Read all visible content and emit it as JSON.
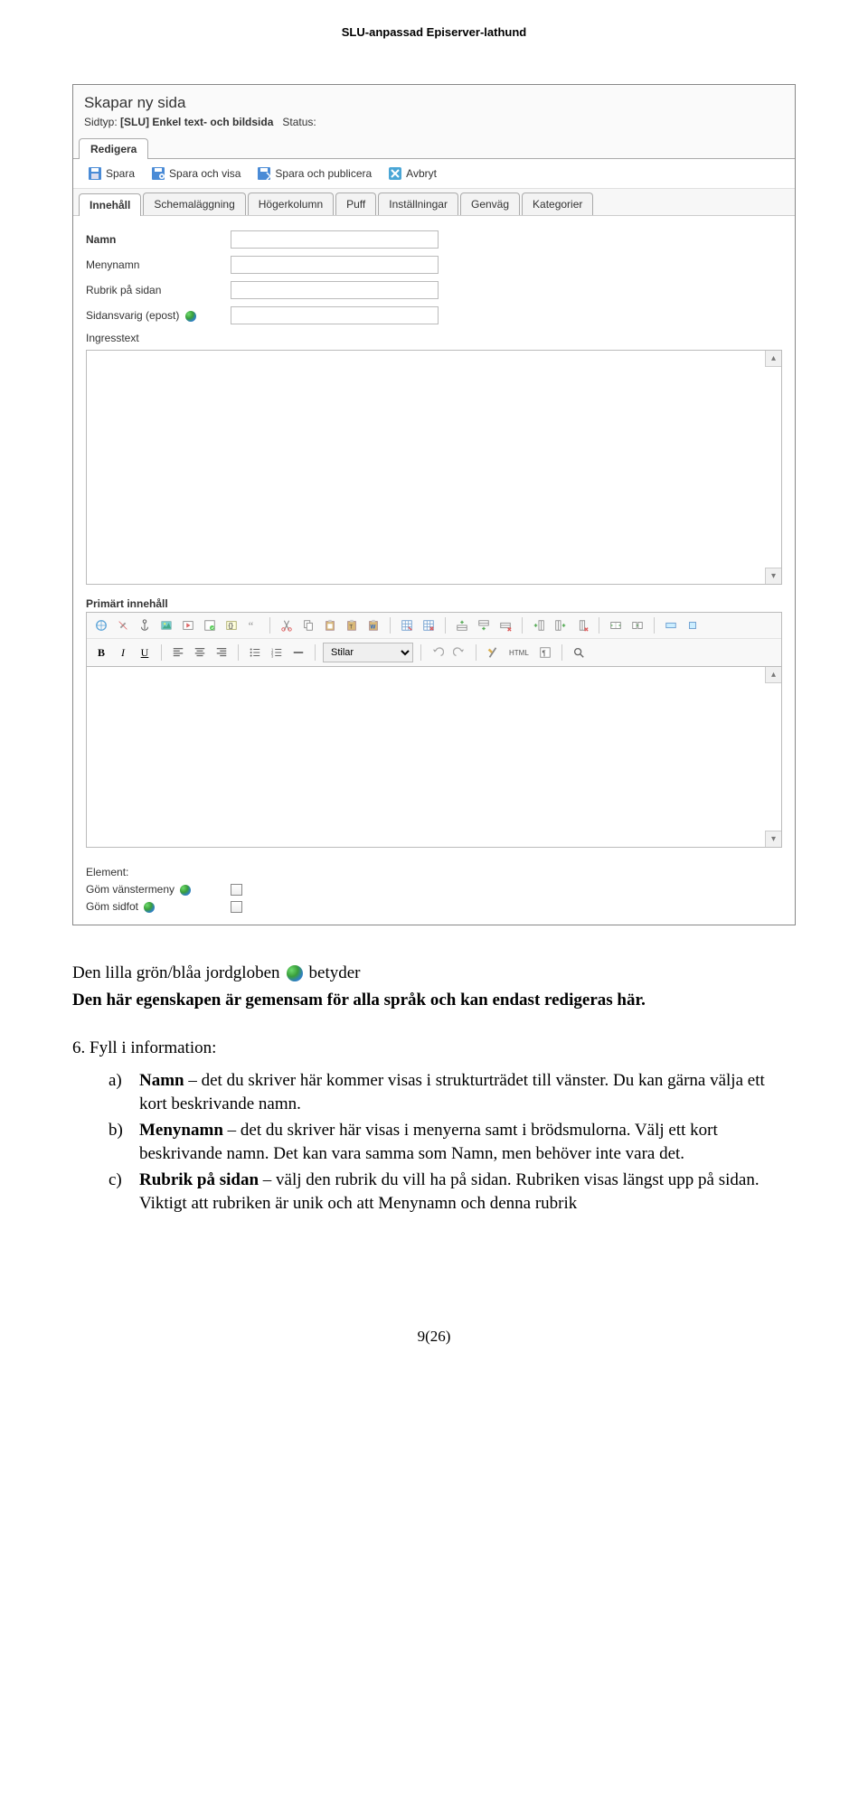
{
  "doc": {
    "header": "SLU-anpassad Episerver-lathund",
    "page_num": "9(26)"
  },
  "editor": {
    "title": "Skapar ny sida",
    "meta": {
      "label": "Sidtyp:",
      "type": "[SLU] Enkel text- och bildsida",
      "status_label": "Status:"
    },
    "main_tab": "Redigera",
    "actions": {
      "save": "Spara",
      "save_view": "Spara och visa",
      "save_publish": "Spara och publicera",
      "cancel": "Avbryt"
    },
    "subtabs": [
      "Innehåll",
      "Schemaläggning",
      "Högerkolumn",
      "Puff",
      "Inställningar",
      "Genväg",
      "Kategorier"
    ],
    "fields": {
      "name": "Namn",
      "menuname": "Menynamn",
      "heading": "Rubrik på sidan",
      "owner": "Sidansvarig (epost)",
      "ingress": "Ingresstext",
      "primary": "Primärt innehåll",
      "styles_label": "Stilar",
      "html_label": "HTML",
      "element_label": "Element:",
      "hide_left": "Göm vänstermeny",
      "hide_foot": "Göm sidfot"
    }
  },
  "text": {
    "p1a": "Den lilla grön/blåa jordgloben",
    "p1b": "betyder",
    "p1c": "Den här egenskapen är gemensam för alla språk och kan endast redigeras här.",
    "step6": "6.  Fyll i information:",
    "a_letter": "a)",
    "a_b": "Namn",
    "a_t": " – det du skriver här kommer visas i strukturträdet till vänster. Du kan gärna välja ett kort beskrivande namn.",
    "b_letter": "b)",
    "b_b": "Menynamn",
    "b_t": " – det du skriver här visas i menyerna samt i brödsmulorna. Välj ett kort beskrivande namn. Det kan vara samma som Namn, men behöver inte vara det.",
    "c_letter": "c)",
    "c_b": "Rubrik på sidan",
    "c_t": " – välj den rubrik du vill ha på sidan. Rubriken visas längst upp på sidan.",
    "c_t2": "Viktigt att rubriken är unik och att Menynamn och denna rubrik"
  }
}
